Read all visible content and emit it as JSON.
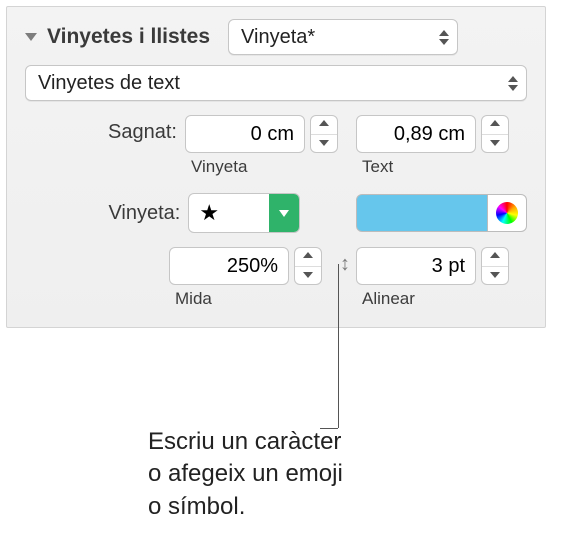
{
  "section": {
    "title": "Vinyetes i llistes"
  },
  "preset": {
    "name": "Vinyeta*"
  },
  "type": {
    "value": "Vinyetes de text"
  },
  "indent": {
    "label": "Sagnat:",
    "bullet_value": "0 cm",
    "bullet_caption": "Vinyeta",
    "text_value": "0,89 cm",
    "text_caption": "Text"
  },
  "bullet": {
    "label": "Vinyeta:",
    "char": "★",
    "color": "#66c6ec"
  },
  "size": {
    "value": "250%",
    "caption": "Mida"
  },
  "align": {
    "value": "3 pt",
    "caption": "Alinear"
  },
  "callout": {
    "line1": "Escriu un caràcter",
    "line2": "o afegeix un emoji",
    "line3": "o símbol."
  }
}
